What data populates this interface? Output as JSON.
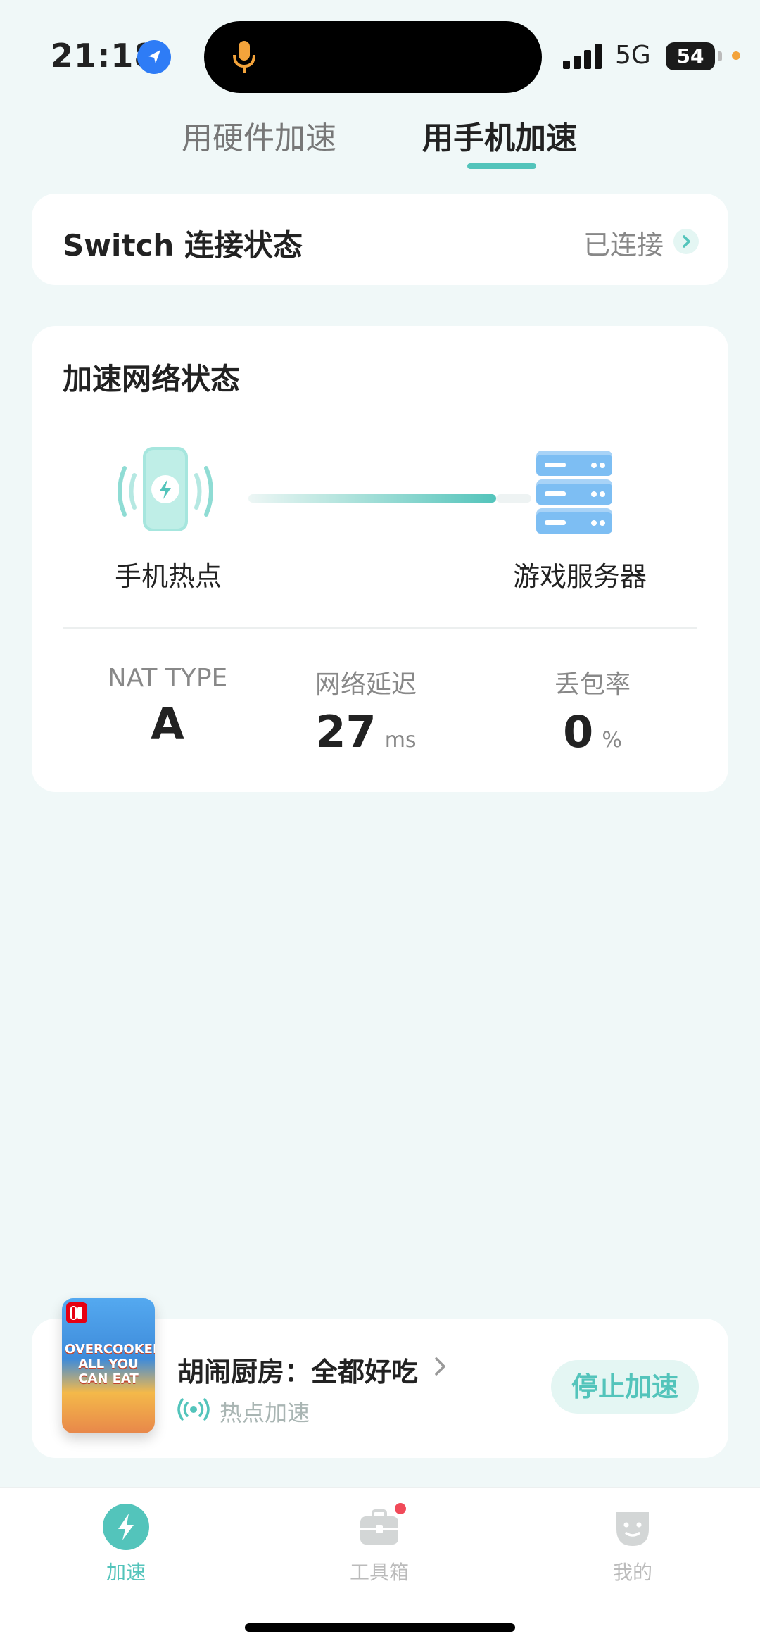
{
  "status_bar": {
    "time": "21:18",
    "network": "5G",
    "battery": "54"
  },
  "tabs": [
    {
      "label": "用硬件加速",
      "active": false
    },
    {
      "label": "用手机加速",
      "active": true
    }
  ],
  "switch_card": {
    "title": "Switch 连接状态",
    "status": "已连接"
  },
  "network_card": {
    "title": "加速网络状态",
    "left_node": "手机热点",
    "right_node": "游戏服务器",
    "stats": [
      {
        "label": "NAT TYPE",
        "value": "A",
        "unit": ""
      },
      {
        "label": "网络延迟",
        "value": "27",
        "unit": "ms"
      },
      {
        "label": "丢包率",
        "value": "0",
        "unit": "%"
      }
    ]
  },
  "game_card": {
    "cover_title": "OVERCOOKED! ALL YOU CAN EAT",
    "name": "胡闹厨房：全都好吃",
    "mode": "热点加速",
    "stop_button": "停止加速"
  },
  "bottom_nav": [
    {
      "label": "加速",
      "icon": "lightning-icon",
      "active": true
    },
    {
      "label": "工具箱",
      "icon": "toolbox-icon",
      "active": false,
      "badge": true
    },
    {
      "label": "我的",
      "icon": "profile-icon",
      "active": false
    }
  ],
  "colors": {
    "accent": "#53C4BB",
    "background": "#F0F8F8",
    "badge": "#F14A59"
  }
}
